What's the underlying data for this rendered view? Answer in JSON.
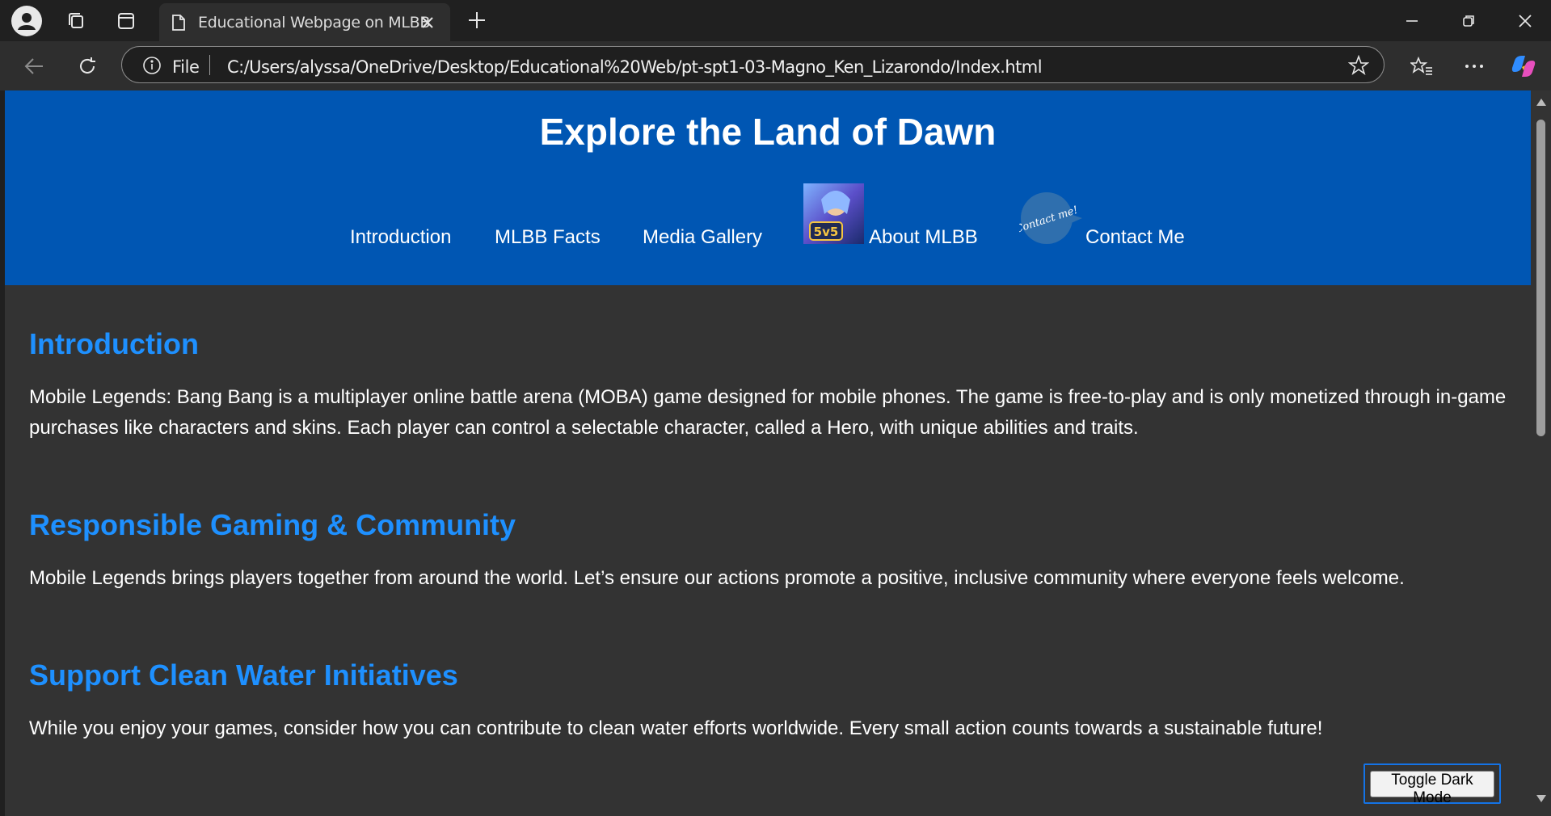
{
  "browser": {
    "tab": {
      "title": "Educational Webpage on MLBB"
    },
    "address": {
      "scheme_label": "File",
      "url": "C:/Users/alyssa/OneDrive/Desktop/Educational%20Web/pt-spt1-03-Magno_Ken_Lizarondo/Index.html"
    }
  },
  "header": {
    "title": "Explore the Land of Dawn",
    "nav": [
      {
        "label": "Introduction"
      },
      {
        "label": "MLBB Facts"
      },
      {
        "label": "Media Gallery"
      },
      {
        "label": "About MLBB",
        "image_text": "5v5"
      },
      {
        "label": "Contact Me",
        "image_text": "Contact me!"
      }
    ]
  },
  "sections": [
    {
      "title": "Introduction",
      "text": "Mobile Legends: Bang Bang is a multiplayer online battle arena (MOBA) game designed for mobile phones. The game is free-to-play and is only monetized through in-game purchases like characters and skins. Each player can control a selectable character, called a Hero, with unique abilities and traits."
    },
    {
      "title": "Responsible Gaming & Community",
      "text": "Mobile Legends brings players together from around the world. Let’s ensure our actions promote a positive, inclusive community where everyone feels welcome."
    },
    {
      "title": "Support Clean Water Initiatives",
      "text": "While you enjoy your games, consider how you can contribute to clean water efforts worldwide. Every small action counts towards a sustainable future!"
    }
  ],
  "toggle_button": {
    "label": "Toggle Dark Mode"
  },
  "colors": {
    "header_bg": "#0056b3",
    "page_bg": "#333333",
    "section_title": "#1e90ff"
  }
}
